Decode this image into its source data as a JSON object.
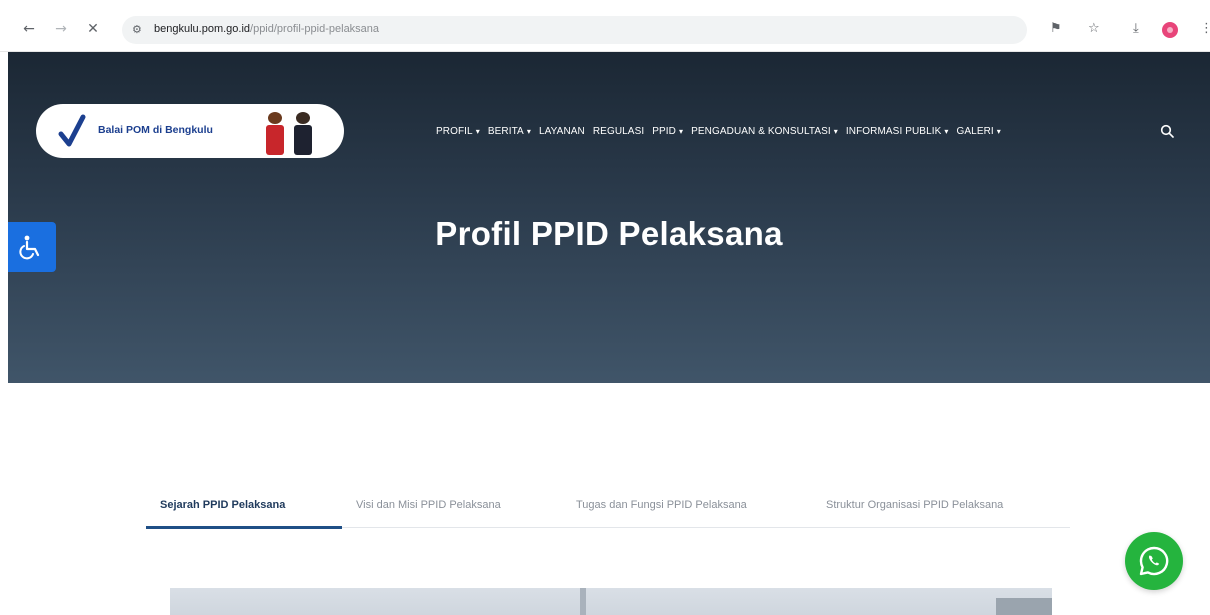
{
  "browser": {
    "url_domain": "bengkulu.pom.go.id",
    "url_path": "/ppid/profil-ppid-pelaksana",
    "icons": [
      "back-arrow-icon",
      "forward-arrow-icon",
      "close-icon",
      "site-info-icon",
      "translate-icon",
      "star-icon",
      "download-icon",
      "profile-icon",
      "menu-icon"
    ]
  },
  "header": {
    "logo_text": "Balai POM di Bengkulu",
    "nav": [
      {
        "label": "PROFIL",
        "dropdown": true
      },
      {
        "label": "BERITA",
        "dropdown": true
      },
      {
        "label": "LAYANAN",
        "dropdown": false
      },
      {
        "label": "REGULASI",
        "dropdown": false
      },
      {
        "label": "PPID",
        "dropdown": true
      },
      {
        "label": "PENGADUAN & KONSULTASI",
        "dropdown": true
      },
      {
        "label": "INFORMASI PUBLIK",
        "dropdown": true
      },
      {
        "label": "GALERI",
        "dropdown": true
      }
    ],
    "caret": "▾"
  },
  "hero": {
    "title": "Profil PPID Pelaksana"
  },
  "tabs": [
    {
      "label": "Sejarah PPID Pelaksana",
      "active": true
    },
    {
      "label": "Visi dan Misi PPID Pelaksana",
      "active": false
    },
    {
      "label": "Tugas dan Fungsi PPID Pelaksana",
      "active": false
    },
    {
      "label": "Struktur Organisasi PPID Pelaksana",
      "active": false
    }
  ],
  "colors": {
    "hero_top": "#1b2734",
    "hero_bottom": "#405569",
    "accent_blue": "#1a6fe0",
    "tab_active": "#1f3a5c",
    "whatsapp_green": "#25b43e"
  }
}
